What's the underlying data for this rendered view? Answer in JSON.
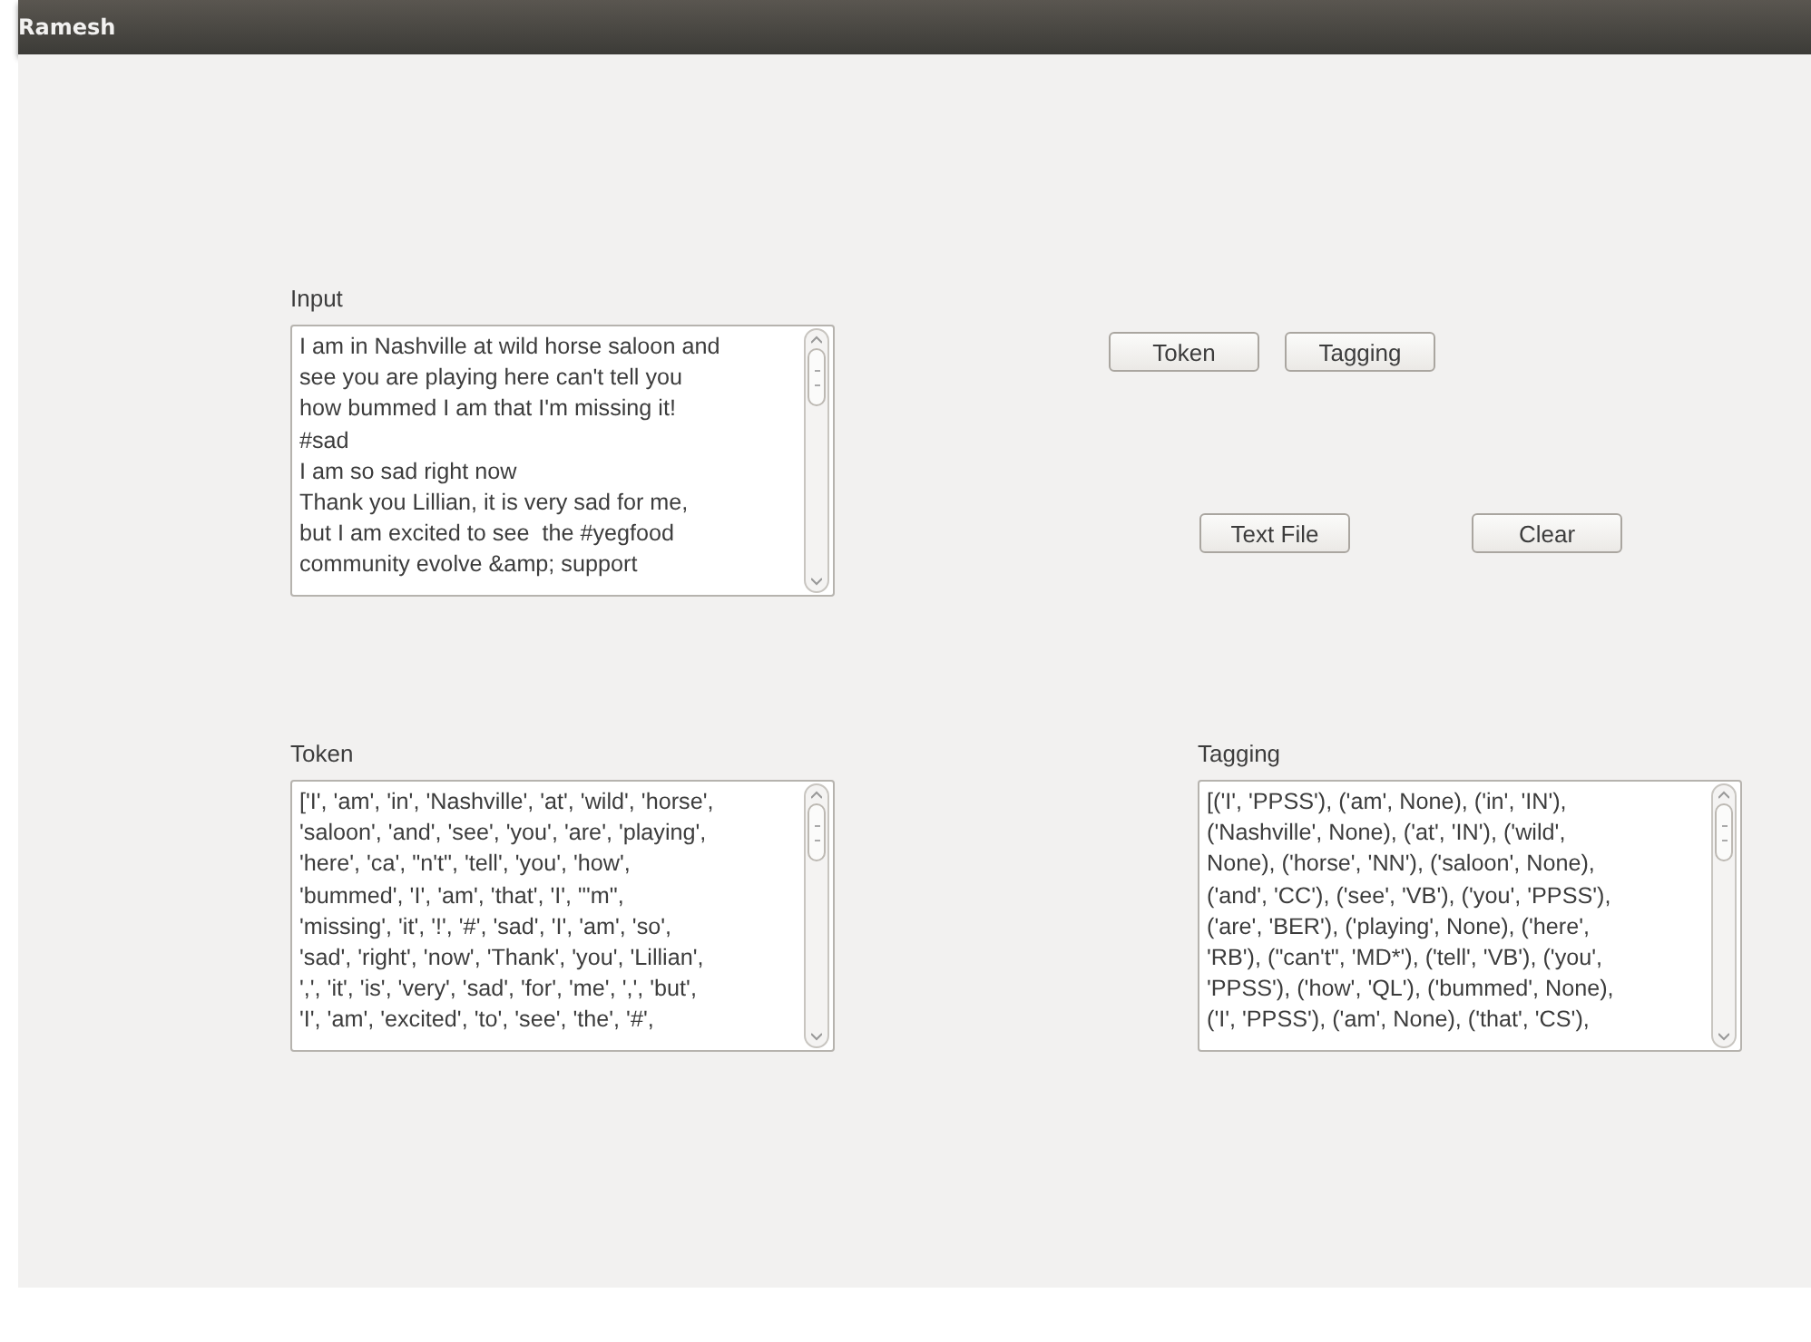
{
  "window": {
    "title": "Ramesh"
  },
  "input": {
    "label": "Input",
    "text": "I am in Nashville at wild horse saloon and\nsee you are playing here can't tell you\nhow bummed I am that I'm missing it!\n#sad\nI am so sad right now\nThank you Lillian, it is very sad for me,\nbut I am excited to see  the #yegfood\ncommunity evolve &amp; support"
  },
  "buttons": [
    {
      "label": "Token"
    },
    {
      "label": "Tagging"
    },
    {
      "label": "Text File"
    },
    {
      "label": "Clear"
    }
  ],
  "token_output": {
    "label": "Token",
    "text": "['I', 'am', 'in', 'Nashville', 'at', 'wild', 'horse',\n'saloon', 'and', 'see', 'you', 'are', 'playing',\n'here', 'ca', \"n't\", 'tell', 'you', 'how',\n'bummed', 'I', 'am', 'that', 'I', \"'m\",\n'missing', 'it', '!', '#', 'sad', 'I', 'am', 'so',\n'sad', 'right', 'now', 'Thank', 'you', 'Lillian',\n',', 'it', 'is', 'very', 'sad', 'for', 'me', ',', 'but',\n'I', 'am', 'excited', 'to', 'see', 'the', '#',"
  },
  "tagging_output": {
    "label": "Tagging",
    "text": "[('I', 'PPSS'), ('am', None), ('in', 'IN'),\n('Nashville', None), ('at', 'IN'), ('wild',\nNone), ('horse', 'NN'), ('saloon', None),\n('and', 'CC'), ('see', 'VB'), ('you', 'PPSS'),\n('are', 'BER'), ('playing', None), ('here',\n'RB'), (\"can't\", 'MD*'), ('tell', 'VB'), ('you',\n'PPSS'), ('how', 'QL'), ('bummed', None),\n('I', 'PPSS'), ('am', None), ('that', 'CS'),"
  }
}
